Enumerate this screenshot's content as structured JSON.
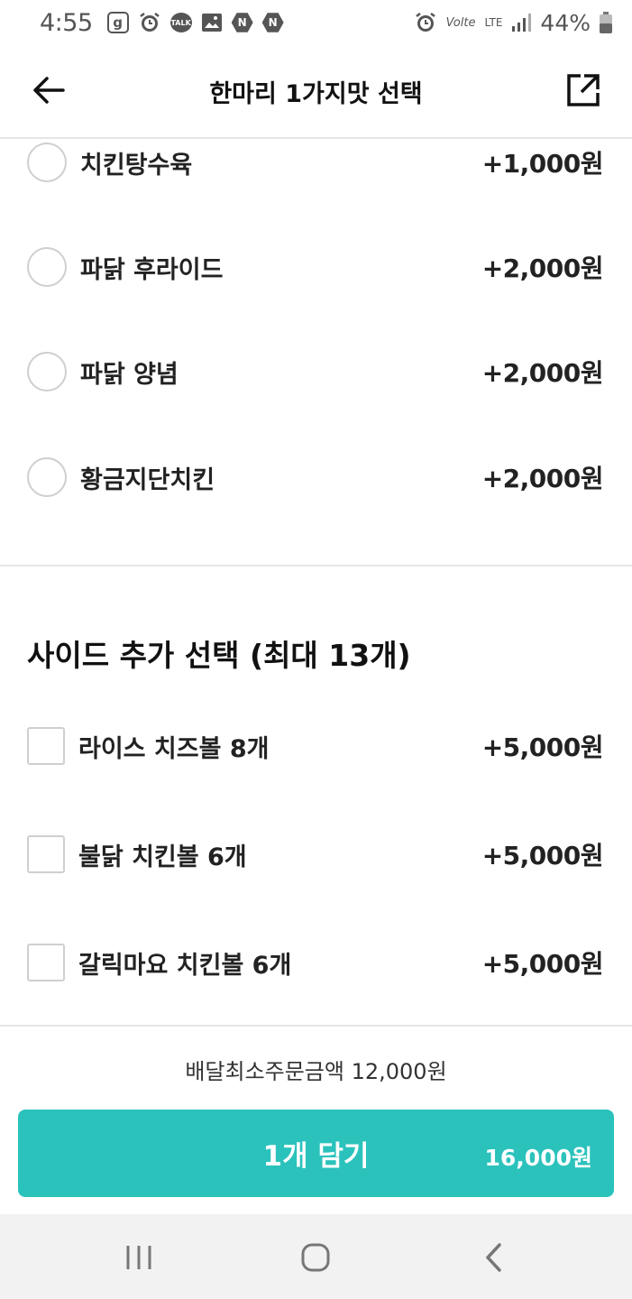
{
  "status_bar": {
    "time": "4:55",
    "icons_left": [
      "g-app-icon",
      "alarm-icon",
      "talk-icon",
      "gallery-icon",
      "n-icon",
      "n-icon"
    ],
    "talk_label": "TALK",
    "g_label": "g",
    "n_label": "N",
    "volte_label": "Volte",
    "lte_label": "LTE",
    "battery": "44%"
  },
  "header": {
    "title": "한마리 1가지맛 선택"
  },
  "radio_options": [
    {
      "label": "치킨탕수육",
      "price": "+1,000원"
    },
    {
      "label": "파닭 후라이드",
      "price": "+2,000원"
    },
    {
      "label": "파닭 양념",
      "price": "+2,000원"
    },
    {
      "label": "황금지단치킨",
      "price": "+2,000원"
    }
  ],
  "side_section": {
    "title": "사이드 추가 선택 (최대 13개)",
    "options": [
      {
        "label": "라이스 치즈볼 8개",
        "price": "+5,000원"
      },
      {
        "label": "불닭 치킨볼 6개",
        "price": "+5,000원"
      },
      {
        "label": "갈릭마요 치킨볼 6개",
        "price": "+5,000원"
      }
    ]
  },
  "footer": {
    "min_order": "배달최소주문금액 12,000원",
    "cart_button_label": "1개 담기",
    "cart_total": "16,000원",
    "accent_color": "#2bc2bc"
  },
  "nav_bar": {
    "buttons": [
      "recent-apps-icon",
      "home-icon",
      "back-icon"
    ]
  }
}
